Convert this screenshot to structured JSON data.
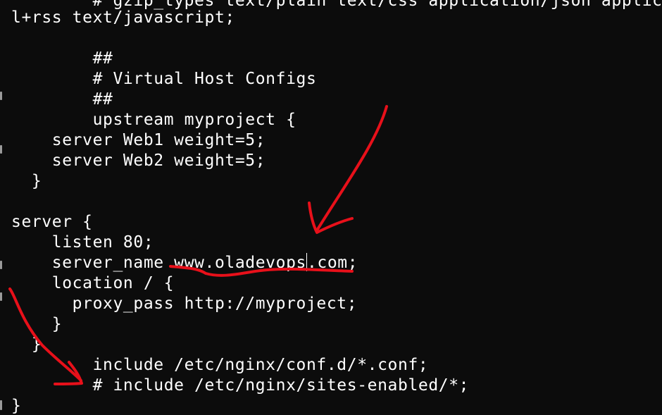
{
  "terminal": {
    "background": "#0c0c0c",
    "foreground": "#ffffff",
    "annotation_color": "#e8101a",
    "lines": [
      "        # gzip_types text/plain text/css application/json applicat",
      "l+rss text/javascript;",
      "",
      "        ##",
      "        # Virtual Host Configs",
      "        ##",
      "        upstream myproject {",
      "    server Web1 weight=5;",
      "    server Web2 weight=5;",
      "  }",
      "",
      "server {",
      "    listen 80;",
      "    server_name www.oladevops",
      "    location / {",
      "      proxy_pass http://myproject;",
      "    }",
      "  }",
      "        include /etc/nginx/conf.d/*.conf;",
      "        # include /etc/nginx/sites-enabled/*;",
      "}"
    ],
    "cursor_line": {
      "before_cursor": "    server_name www.oladevops",
      "after_cursor": ".com;"
    }
  }
}
